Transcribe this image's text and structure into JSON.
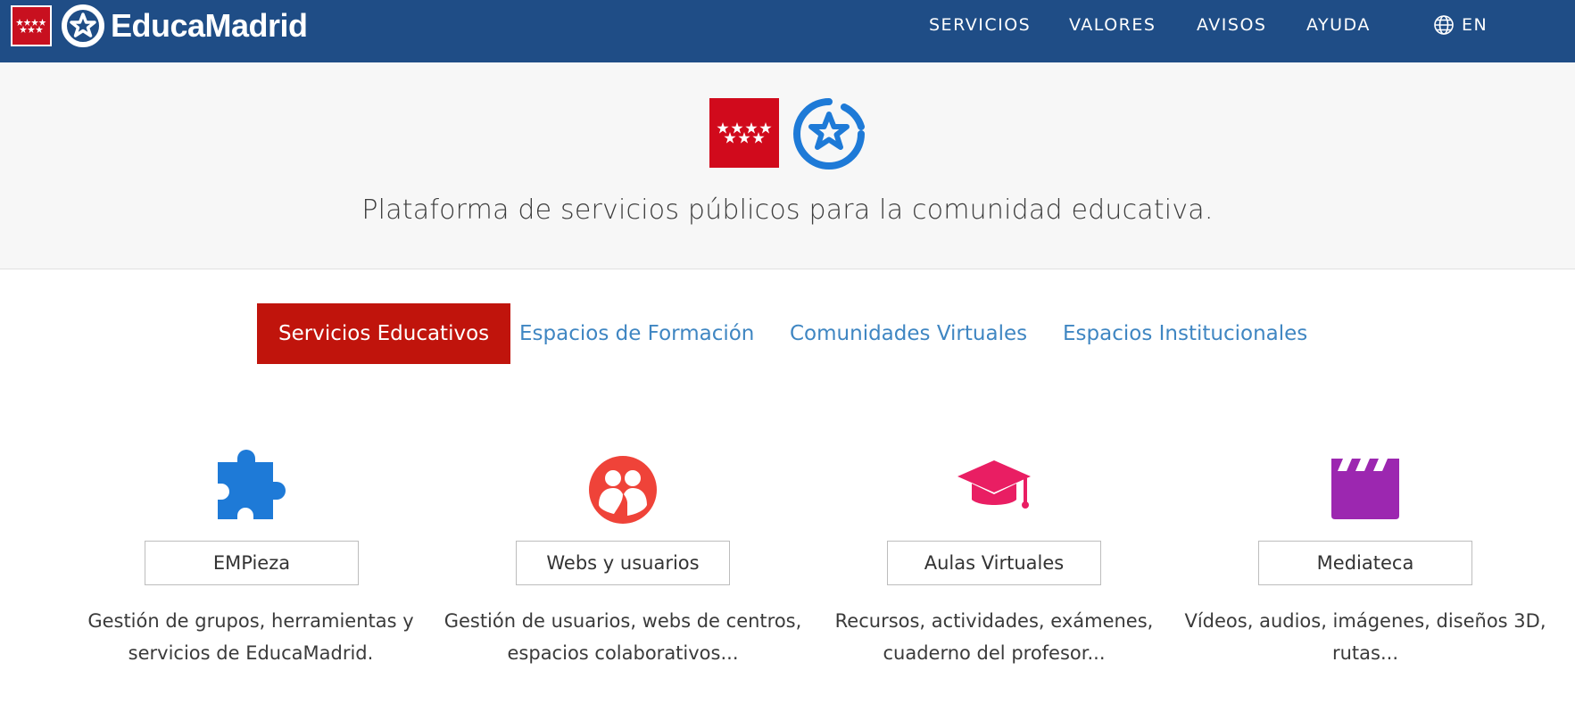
{
  "header": {
    "brand_name": "EducaMadrid",
    "nav": [
      {
        "label": "SERVICIOS"
      },
      {
        "label": "VALORES"
      },
      {
        "label": "AVISOS"
      },
      {
        "label": "AYUDA"
      }
    ],
    "language": "EN"
  },
  "hero": {
    "tagline": "Plataforma de servicios públicos para la comunidad educativa."
  },
  "tabs": [
    {
      "label": "Servicios Educativos",
      "active": true
    },
    {
      "label": "Espacios de Formación",
      "active": false
    },
    {
      "label": "Comunidades Virtuales",
      "active": false
    },
    {
      "label": "Espacios Institucionales",
      "active": false
    }
  ],
  "services": [
    {
      "title": "EMPieza",
      "description": "Gestión de grupos, herramientas y servicios de EducaMadrid.",
      "icon": "puzzle-icon",
      "color": "#1e7ad7"
    },
    {
      "title": "Webs y usuarios",
      "description": "Gestión de usuarios, webs de centros, espacios colaborativos...",
      "icon": "users-icon",
      "color": "#ef4339"
    },
    {
      "title": "Aulas Virtuales",
      "description": "Recursos, actividades, exámenes, cuaderno del profesor...",
      "icon": "graduation-cap-icon",
      "color": "#e91e63"
    },
    {
      "title": "Mediateca",
      "description": "Vídeos, audios, imágenes, diseños 3D, rutas...",
      "icon": "clapperboard-icon",
      "color": "#9c27b0"
    }
  ],
  "colors": {
    "header_bg": "#1f4d86",
    "accent_red": "#c0140c",
    "tab_link": "#3f86c2"
  }
}
